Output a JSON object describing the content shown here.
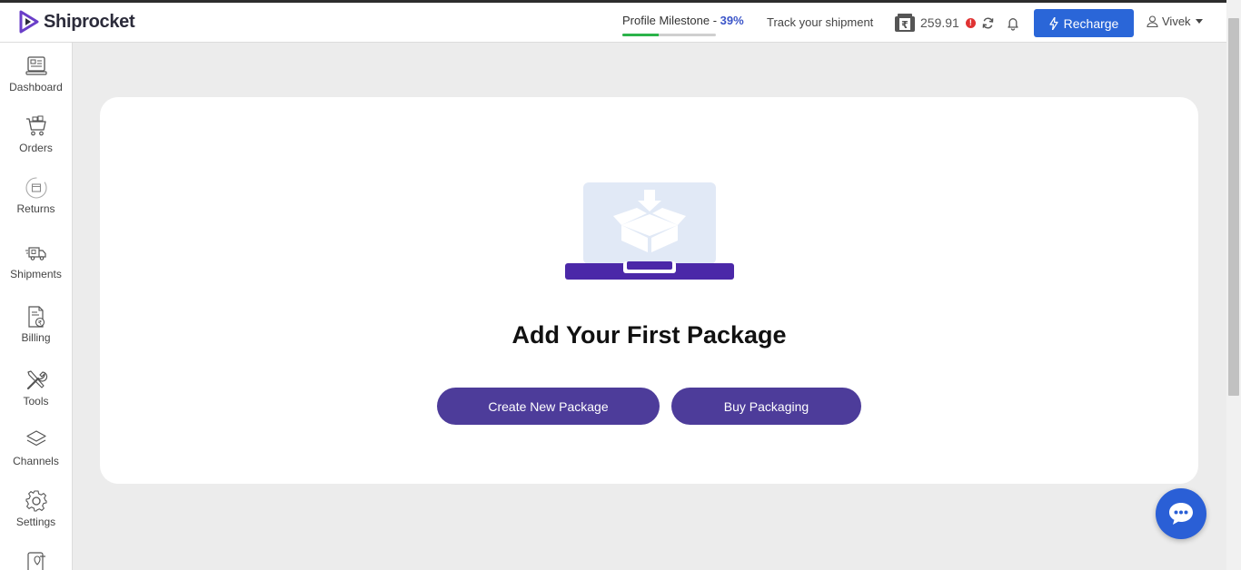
{
  "header": {
    "logo_text": "Shiprocket",
    "milestone_label": "Profile Milestone - ",
    "milestone_percent": "39%",
    "milestone_progress": 0.39,
    "track_label": "Track your shipment",
    "wallet_amount": "259.91",
    "alert_symbol": "!",
    "recharge_label": "Recharge",
    "user_name": "Vivek"
  },
  "sidebar": {
    "items": [
      {
        "label": "Dashboard",
        "icon": "dashboard-icon"
      },
      {
        "label": "Orders",
        "icon": "cart-icon"
      },
      {
        "label": "Returns",
        "icon": "returns-icon"
      },
      {
        "label": "Shipments",
        "icon": "truck-icon"
      },
      {
        "label": "Billing",
        "icon": "billing-icon"
      },
      {
        "label": "Tools",
        "icon": "tools-icon"
      },
      {
        "label": "Channels",
        "icon": "layers-icon"
      },
      {
        "label": "Settings",
        "icon": "gear-icon"
      },
      {
        "label": "",
        "icon": "location-device-icon"
      }
    ]
  },
  "main": {
    "title": "Add Your First Package",
    "create_button": "Create New Package",
    "buy_button": "Buy Packaging"
  },
  "colors": {
    "brand_purple": "#4d3c9a",
    "recharge_blue": "#2a66d8",
    "milestone_green": "#2bb34a",
    "milestone_blue": "#3a54c8",
    "alert_red": "#e03333",
    "chat_blue": "#2a5fd6"
  }
}
